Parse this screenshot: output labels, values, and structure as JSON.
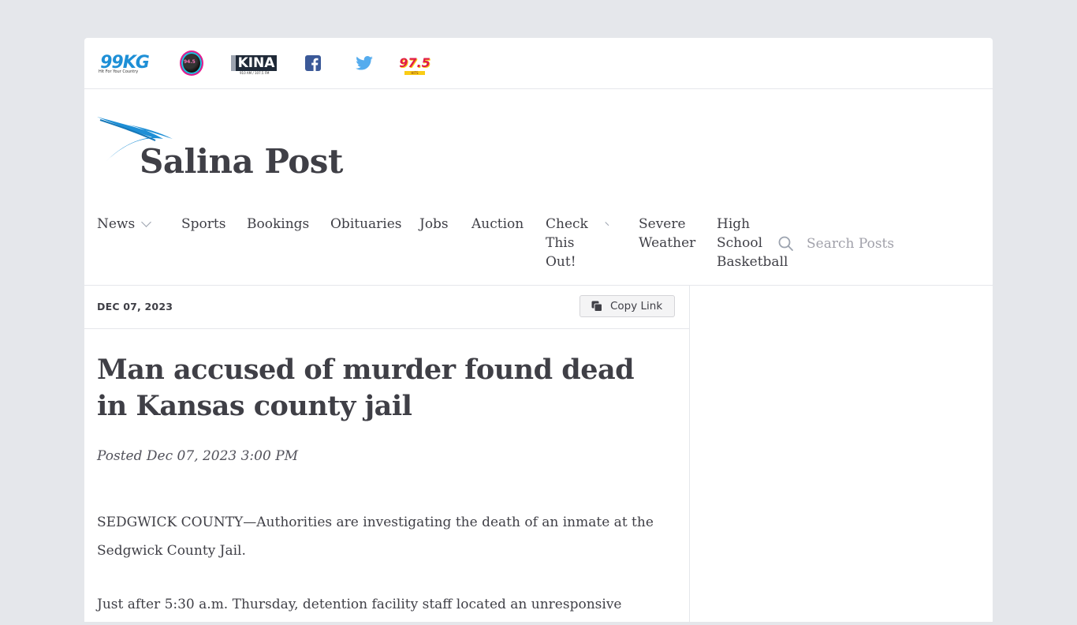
{
  "stations": [
    {
      "label": "99KG",
      "tagline": "Hit For Your Country",
      "icon": "99kg-logo-icon"
    },
    {
      "label": "94.5",
      "icon": "radio-circle-logo-icon"
    },
    {
      "label": "KINA",
      "tagline": "910 AM / 107.5 FM",
      "icon": "kina-logo-icon"
    },
    {
      "icon": "facebook-icon"
    },
    {
      "icon": "twitter-icon"
    },
    {
      "label": "97.5",
      "tagline": "HITS",
      "icon": "975-logo-icon"
    }
  ],
  "site": {
    "name": "Salina Post",
    "brand_color": "#1e8fd6"
  },
  "nav": {
    "items": [
      {
        "label": "News",
        "has_dropdown": true
      },
      {
        "label": "Sports"
      },
      {
        "label": "Bookings"
      },
      {
        "label": "Obituaries"
      },
      {
        "label": "Jobs"
      },
      {
        "label": "Auction"
      },
      {
        "label": "Check This Out!",
        "has_dropdown": true
      },
      {
        "label": "Severe Weather"
      },
      {
        "label": "High School Basketball"
      }
    ],
    "search_placeholder": "Search Posts"
  },
  "article": {
    "date": "DEC 07, 2023",
    "copy_link_label": "Copy Link",
    "title": "Man accused of murder found dead in Kansas county jail",
    "posted": "Posted Dec 07, 2023 3:00 PM",
    "paragraphs": [
      "SEDGWICK COUNTY—Authorities are investigating the death of an inmate at the Sedgwick County Jail.",
      "Just after 5:30 a.m. Thursday, detention facility staff located an unresponsive"
    ]
  }
}
